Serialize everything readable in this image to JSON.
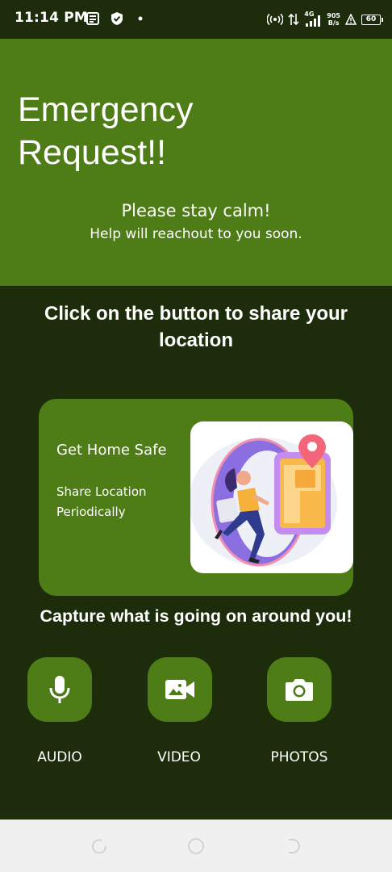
{
  "status_bar": {
    "time": "11:14 PM",
    "network": "4G",
    "speed_value": "905",
    "speed_unit": "B/s",
    "battery": "60"
  },
  "header": {
    "title_line1": "Emergency",
    "title_line2": "Request!!",
    "subtitle": "Please stay calm!",
    "subtitle2": "Help will reachout to you soon."
  },
  "share": {
    "heading": "Click on the button to share your location"
  },
  "card": {
    "title": "Get Home Safe",
    "description": "Share Location Periodically"
  },
  "capture": {
    "heading": "Capture what is going on around you!",
    "buttons": [
      {
        "label": "AUDIO",
        "icon": "microphone-icon"
      },
      {
        "label": "VIDEO",
        "icon": "video-camera-icon"
      },
      {
        "label": "PHOTOS",
        "icon": "camera-icon"
      }
    ]
  },
  "colors": {
    "header_green": "#4e7c17",
    "dark_green": "#1d2d0c",
    "nav_bar": "#f0f0f0"
  }
}
